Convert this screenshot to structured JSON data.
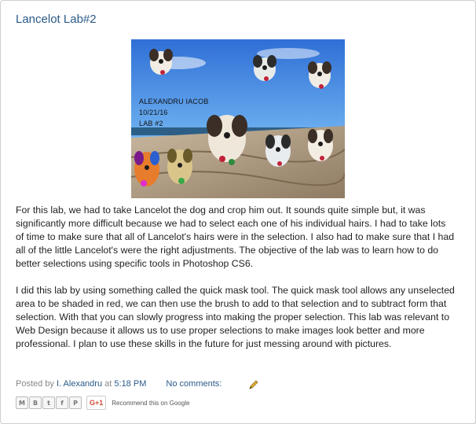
{
  "post": {
    "title": "Lancelot Lab#2",
    "image_caption": [
      "ALEXANDRU IACOB",
      "10/21/16",
      "LAB #2"
    ],
    "paragraphs": [
      "For this lab, we had to take Lancelot the dog and crop him out. It sounds quite simple but, it was significantly more difficult because we had to select each one of his individual hairs. I had to take lots of time to make sure that all of Lancelot's hairs were in the selection. I also had to make sure that I had all of the little Lancelot's were the right adjustments. The objective of the lab was to learn how to do better selections using specific tools in Photoshop CS6.",
      "I did this lab by using something called the quick mask tool. The quick mask tool allows any unselected area to be shaded in red, we can then use the brush to add to that selection and to subtract form that selection. With that you can slowly progress into making the proper selection. This lab was relevant to Web Design because it allows us to use proper selections to make images look better and more professional. I plan to use these skills in the future for just messing around with pictures."
    ]
  },
  "footer": {
    "posted_by": "Posted by",
    "author": "I. Alexandru",
    "at": "at",
    "time": "5:18 PM",
    "comments": "No comments:"
  },
  "share": {
    "buttons": [
      {
        "icon": "email-icon",
        "glyph": "M"
      },
      {
        "icon": "blogthis-icon",
        "glyph": "B"
      },
      {
        "icon": "twitter-icon",
        "glyph": "t"
      },
      {
        "icon": "facebook-icon",
        "glyph": "f"
      },
      {
        "icon": "pinterest-icon",
        "glyph": "P"
      }
    ],
    "gplus_label": "G+1",
    "recommend": "Recommend this on Google"
  },
  "colors": {
    "link": "#2a5a89",
    "sky": "#3d8fe0",
    "wood": "#b9a58c",
    "gplus": "#d14836"
  }
}
